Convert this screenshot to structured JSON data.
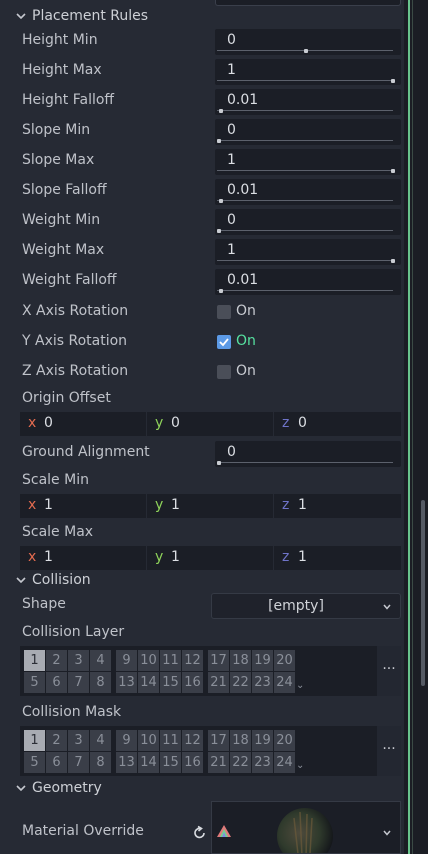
{
  "placement": {
    "title": "Placement Rules",
    "rows": [
      {
        "label": "Height Min",
        "value": "0",
        "level": 0.5
      },
      {
        "label": "Height Max",
        "value": "1",
        "level": 1
      },
      {
        "label": "Height Falloff",
        "value": "0.01",
        "level": 0.01
      },
      {
        "label": "Slope Min",
        "value": "0",
        "level": 0
      },
      {
        "label": "Slope Max",
        "value": "1",
        "level": 1
      },
      {
        "label": "Slope Falloff",
        "value": "0.01",
        "level": 0.01
      },
      {
        "label": "Weight Min",
        "value": "0",
        "level": 0
      },
      {
        "label": "Weight Max",
        "value": "1",
        "level": 1
      },
      {
        "label": "Weight Falloff",
        "value": "0.01",
        "level": 0.01
      }
    ],
    "x_rot": {
      "label": "X Axis Rotation",
      "text": "On",
      "checked": false
    },
    "y_rot": {
      "label": "Y Axis Rotation",
      "text": "On",
      "checked": true
    },
    "z_rot": {
      "label": "Z Axis Rotation",
      "text": "On",
      "checked": false
    },
    "origin": {
      "label": "Origin Offset",
      "x": "0",
      "y": "0",
      "z": "0"
    },
    "ground": {
      "label": "Ground Alignment",
      "value": "0",
      "level": 0
    },
    "scale_min": {
      "label": "Scale Min",
      "x": "1",
      "y": "1",
      "z": "1"
    },
    "scale_max": {
      "label": "Scale Max",
      "x": "1",
      "y": "1",
      "z": "1"
    },
    "axes": {
      "x": "x",
      "y": "y",
      "z": "z"
    }
  },
  "collision": {
    "title": "Collision",
    "shape_label": "Shape",
    "shape_value": "[empty]",
    "layer_label": "Collision Layer",
    "mask_label": "Collision Mask",
    "layer_nums": [
      "1",
      "2",
      "3",
      "4",
      "5",
      "6",
      "7",
      "8",
      "9",
      "10",
      "11",
      "12",
      "13",
      "14",
      "15",
      "16",
      "17",
      "18",
      "19",
      "20",
      "21",
      "22",
      "23",
      "24"
    ],
    "selected": "1",
    "more": "..."
  },
  "geometry": {
    "title": "Geometry",
    "material_label": "Material Override"
  },
  "colors": {
    "accent": "#5c9ae6",
    "on_text": "#56e1a0",
    "x": "#e36b4f",
    "y": "#8ed25a",
    "z": "#6f74c9"
  }
}
